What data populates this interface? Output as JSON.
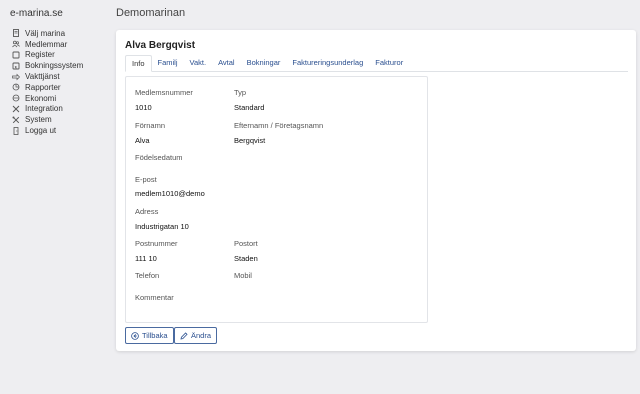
{
  "brand": "e-marina.se",
  "page_title": "Demomarinan",
  "sidebar": {
    "items": [
      {
        "label": "Välj marina",
        "icon": "document-icon"
      },
      {
        "label": "Medlemmar",
        "icon": "users-icon"
      },
      {
        "label": "Register",
        "icon": "square-icon"
      },
      {
        "label": "Bokningssystem",
        "icon": "bookmark-icon"
      },
      {
        "label": "Vakttjänst",
        "icon": "arrow-icon"
      },
      {
        "label": "Rapporter",
        "icon": "chart-icon"
      },
      {
        "label": "Ekonomi",
        "icon": "balance-icon"
      },
      {
        "label": "Integration",
        "icon": "tools-icon"
      },
      {
        "label": "System",
        "icon": "wrench-icon"
      },
      {
        "label": "Logga ut",
        "icon": "logout-icon"
      }
    ]
  },
  "member": {
    "name": "Alva Bergqvist"
  },
  "tabs": [
    "Info",
    "Familj",
    "Vakt.",
    "Avtal",
    "Bokningar",
    "Faktureringsunderlag",
    "Fakturor"
  ],
  "fields": {
    "medlemsnummer": {
      "label": "Medlemsnummer",
      "value": "1010"
    },
    "typ": {
      "label": "Typ",
      "value": "Standard"
    },
    "fornamn": {
      "label": "Förnamn",
      "value": "Alva"
    },
    "efternamn": {
      "label": "Efternamn / Företagsnamn",
      "value": "Bergqvist"
    },
    "fodelsedatum": {
      "label": "Födelsedatum",
      "value": ""
    },
    "epost": {
      "label": "E-post",
      "value": "medlem1010@demo"
    },
    "adress": {
      "label": "Adress",
      "value": "Industrigatan 10"
    },
    "postnummer": {
      "label": "Postnummer",
      "value": "111 10"
    },
    "postort": {
      "label": "Postort",
      "value": "Staden"
    },
    "telefon": {
      "label": "Telefon",
      "value": ""
    },
    "mobil": {
      "label": "Mobil",
      "value": ""
    },
    "kommentar": {
      "label": "Kommentar",
      "value": ""
    }
  },
  "buttons": {
    "back": "Tillbaka",
    "edit": "Ändra"
  },
  "colors": {
    "accent": "#2a4f8f",
    "background": "#eeeef1"
  }
}
